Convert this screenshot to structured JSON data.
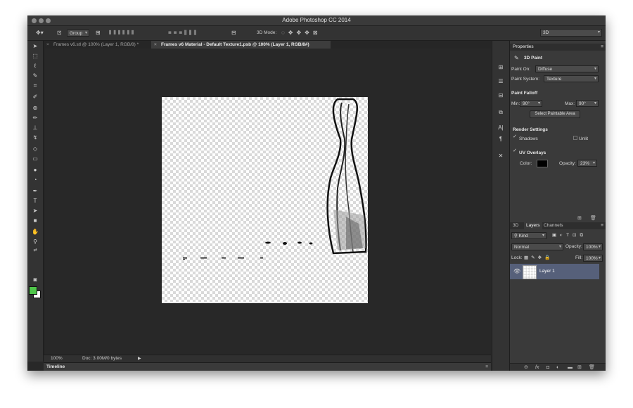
{
  "window": {
    "title": "Adobe Photoshop CC 2014"
  },
  "options_bar": {
    "auto_select_value": "Group",
    "mode_label": "3D Mode:",
    "workspace_value": "3D"
  },
  "tabs": [
    {
      "label": "Frames v6.stl @ 100% (Layer 1, RGB/8) *",
      "active": false
    },
    {
      "label": "Frames v6 Material - Default Texture1.psb @ 100% (Layer 1, RGB/8#)",
      "active": true
    }
  ],
  "status": {
    "zoom": "100%",
    "doc": "Doc: 3.00M/0 bytes"
  },
  "timeline": {
    "label": "Timeline"
  },
  "properties": {
    "tab": "Properties",
    "header": "3D Paint",
    "paint_on_label": "Paint On:",
    "paint_on_value": "Diffuse",
    "paint_system_label": "Paint System:",
    "paint_system_value": "Texture",
    "falloff_title": "Paint Falloff",
    "min_label": "Min:",
    "min_value": "90°",
    "max_label": "Max:",
    "max_value": "90°",
    "select_area_button": "Select Paintable Area",
    "render_title": "Render Settings",
    "shadows_label": "Shadows",
    "unlit_label": "Unlit",
    "uv_label": "UV Overlays",
    "color_label": "Color:",
    "color_value": "#000000",
    "opacity_label": "Opacity:",
    "opacity_value": "23%"
  },
  "layers_panel": {
    "tabs": [
      "3D",
      "Layers",
      "Channels"
    ],
    "active_tab": "Layers",
    "filter_value": "Kind",
    "blend_mode": "Normal",
    "opacity_label": "Opacity:",
    "opacity_value": "100%",
    "lock_label": "Lock:",
    "fill_label": "Fill:",
    "fill_value": "100%",
    "layers": [
      {
        "name": "Layer 1",
        "visible": true
      }
    ]
  },
  "colors": {
    "foreground": "#4fc64a",
    "background": "#ffffff",
    "selected_layer": "#56607a"
  }
}
